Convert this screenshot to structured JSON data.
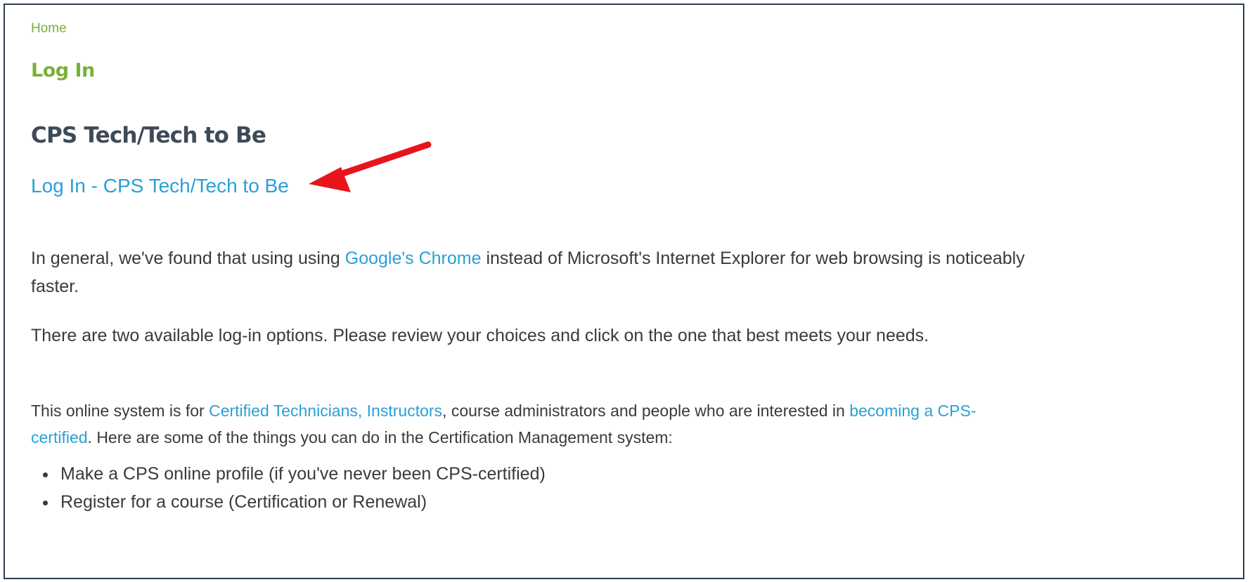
{
  "breadcrumb": {
    "home": "Home"
  },
  "page": {
    "title": "Log In"
  },
  "section": {
    "heading": "CPS Tech/Tech to Be",
    "login_link": "Log In - CPS Tech/Tech to Be"
  },
  "browser_note": {
    "before": "In general, we've found that using using ",
    "link": "Google's Chrome",
    "after": " instead of Microsoft's Internet Explorer for web browsing is noticeably faster."
  },
  "options_note": "There are two available log-in options. Please review your choices and click on the one that best meets your needs.",
  "system_description": {
    "part1": "This online system is for ",
    "link_certified_techs": "Certified Technicians,",
    "space1": " ",
    "link_instructors": "Instructors",
    "part2": ", course administrators and people who are interested in ",
    "link_becoming_certified": "becoming a CPS-certified",
    "part3": ". Here are some of the things you can do in the Certification Management  system:"
  },
  "features": [
    "Make a CPS online profile (if you've never been CPS-certified)",
    "Register for a course (Certification or Renewal)"
  ],
  "annotation": {
    "arrow_color": "#e8141b"
  },
  "colors": {
    "accent_green": "#7ab03c",
    "link_blue": "#2aa0d7",
    "heading_gray": "#3f4a58",
    "body_text": "#3a3a3a",
    "frame_border": "#2e3b55"
  }
}
